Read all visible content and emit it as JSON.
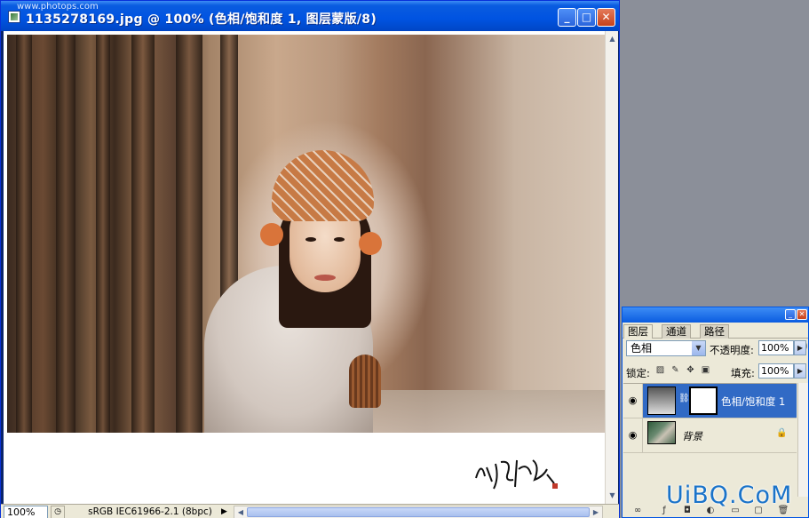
{
  "watermark": "www.photops.com",
  "window": {
    "title": "1135278169.jpg @ 100% (色相/饱和度 1, 图层蒙版/8)",
    "min_label": "_",
    "max_label": "□",
    "close_label": "✕"
  },
  "status": {
    "zoom": "100%",
    "profile": "sRGB IEC61966-2.1 (8bpc)",
    "info_arrow": "▶"
  },
  "palette": {
    "tabs": [
      "图层",
      "通道",
      "路径"
    ],
    "blend_mode": "色相",
    "opacity_label": "不透明度:",
    "opacity_value": "100%",
    "lock_label": "锁定:",
    "fill_label": "填充:",
    "fill_value": "100%",
    "layers": [
      {
        "name": "色相/饱和度 1",
        "selected": true
      },
      {
        "name": "背景",
        "selected": false
      }
    ]
  },
  "brand": "UiBQ.CoM",
  "colors": {
    "title_blue": "#0053e1",
    "selection_blue": "#316ac5",
    "brand_blue": "#1a73c9"
  }
}
